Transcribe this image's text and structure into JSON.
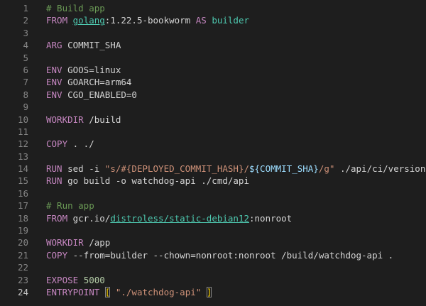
{
  "editor": {
    "active_line": 24,
    "lines": [
      {
        "n": "1",
        "tokens": [
          {
            "t": "# Build app",
            "c": "comment"
          }
        ]
      },
      {
        "n": "2",
        "tokens": [
          {
            "t": "FROM",
            "c": "kw"
          },
          {
            "t": " ",
            "c": "plain"
          },
          {
            "t": "golang",
            "c": "link"
          },
          {
            "t": ":1.22.5-bookworm ",
            "c": "plain"
          },
          {
            "t": "AS",
            "c": "kw"
          },
          {
            "t": " ",
            "c": "plain"
          },
          {
            "t": "builder",
            "c": "builder"
          }
        ]
      },
      {
        "n": "3",
        "tokens": []
      },
      {
        "n": "4",
        "tokens": [
          {
            "t": "ARG",
            "c": "kw"
          },
          {
            "t": " COMMIT_SHA",
            "c": "plain"
          }
        ]
      },
      {
        "n": "5",
        "tokens": []
      },
      {
        "n": "6",
        "tokens": [
          {
            "t": "ENV",
            "c": "kw"
          },
          {
            "t": " GOOS=linux",
            "c": "plain"
          }
        ]
      },
      {
        "n": "7",
        "tokens": [
          {
            "t": "ENV",
            "c": "kw"
          },
          {
            "t": " GOARCH=arm64",
            "c": "plain"
          }
        ]
      },
      {
        "n": "8",
        "tokens": [
          {
            "t": "ENV",
            "c": "kw"
          },
          {
            "t": " CGO_ENABLED=0",
            "c": "plain"
          }
        ]
      },
      {
        "n": "9",
        "tokens": []
      },
      {
        "n": "10",
        "tokens": [
          {
            "t": "WORKDIR",
            "c": "kw"
          },
          {
            "t": " /build",
            "c": "plain"
          }
        ]
      },
      {
        "n": "11",
        "tokens": []
      },
      {
        "n": "12",
        "tokens": [
          {
            "t": "COPY",
            "c": "kw"
          },
          {
            "t": " . ./",
            "c": "plain"
          }
        ]
      },
      {
        "n": "13",
        "tokens": []
      },
      {
        "n": "14",
        "tokens": [
          {
            "t": "RUN",
            "c": "kw"
          },
          {
            "t": " sed -i ",
            "c": "plain"
          },
          {
            "t": "\"s/#{DEPLOYED_COMMIT_HASH}/",
            "c": "string"
          },
          {
            "t": "${COMMIT_SHA}",
            "c": "var"
          },
          {
            "t": "/g\"",
            "c": "string"
          },
          {
            "t": " ./api/ci/version.go",
            "c": "plain"
          }
        ]
      },
      {
        "n": "15",
        "tokens": [
          {
            "t": "RUN",
            "c": "kw"
          },
          {
            "t": " go build -o watchdog-api ./cmd/api",
            "c": "plain"
          }
        ]
      },
      {
        "n": "16",
        "tokens": []
      },
      {
        "n": "17",
        "tokens": [
          {
            "t": "# Run app",
            "c": "comment"
          }
        ]
      },
      {
        "n": "18",
        "tokens": [
          {
            "t": "FROM",
            "c": "kw"
          },
          {
            "t": " gcr.io/",
            "c": "plain"
          },
          {
            "t": "distroless/static-debian12",
            "c": "link"
          },
          {
            "t": ":nonroot",
            "c": "plain"
          }
        ]
      },
      {
        "n": "19",
        "tokens": []
      },
      {
        "n": "20",
        "tokens": [
          {
            "t": "WORKDIR",
            "c": "kw"
          },
          {
            "t": " /app",
            "c": "plain"
          }
        ]
      },
      {
        "n": "21",
        "tokens": [
          {
            "t": "COPY",
            "c": "kw"
          },
          {
            "t": " --from=builder --chown=nonroot:nonroot /build/watchdog-api .",
            "c": "plain"
          }
        ]
      },
      {
        "n": "22",
        "tokens": []
      },
      {
        "n": "23",
        "tokens": [
          {
            "t": "EXPOSE",
            "c": "kw"
          },
          {
            "t": " ",
            "c": "plain"
          },
          {
            "t": "5000",
            "c": "num"
          }
        ]
      },
      {
        "n": "24",
        "tokens": [
          {
            "t": "ENTRYPOINT",
            "c": "kw"
          },
          {
            "t": " ",
            "c": "plain"
          },
          {
            "t": "[",
            "c": "bracket"
          },
          {
            "t": " ",
            "c": "plain"
          },
          {
            "t": "\"./watchdog-api\"",
            "c": "string"
          },
          {
            "t": " ",
            "c": "plain"
          },
          {
            "t": "]",
            "c": "bracket"
          }
        ]
      }
    ]
  },
  "colors": {
    "background": "#1e1e1e",
    "line_number": "#858585",
    "comment": "#6a9955",
    "keyword": "#c586c0",
    "string": "#ce9178",
    "variable": "#9cdcfe",
    "type": "#4ec9b0",
    "number": "#b5cea8",
    "bracket": "#ffd700"
  }
}
